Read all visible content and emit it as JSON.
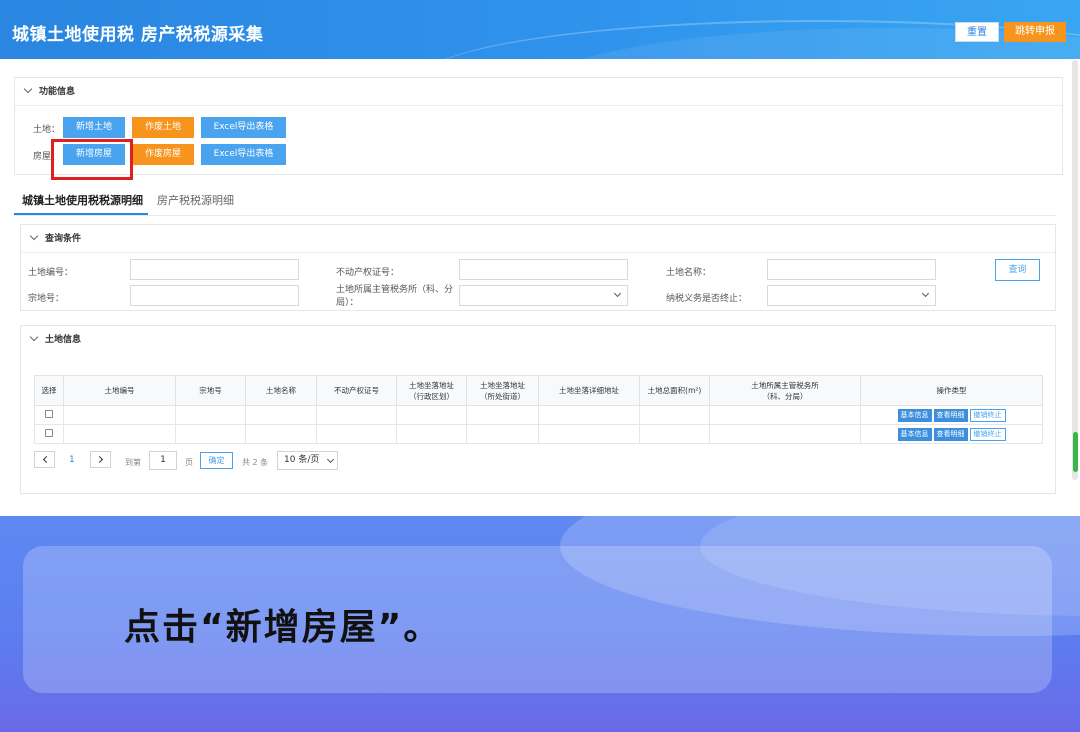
{
  "header": {
    "title": "城镇土地使用税 房产税税源采集",
    "reset_label": "重置",
    "submit_label": "跳转申报"
  },
  "function_panel": {
    "title": "功能信息",
    "land_label": "土地：",
    "house_label": "房屋：",
    "land_buttons": [
      "新增土地",
      "作废土地",
      "Excel导出表格"
    ],
    "house_buttons": [
      "新增房屋",
      "作废房屋",
      "Excel导出表格"
    ]
  },
  "tabs": [
    "城镇土地使用税税源明细",
    "房产税税源明细"
  ],
  "query": {
    "title": "查询条件",
    "fields": {
      "land_no": "土地编号：",
      "property_cert": "不动产权证号：",
      "land_name": "土地名称：",
      "parcel_no": "宗地号：",
      "tax_office": "土地所属主管税务所（科、分局）：",
      "tax_terminated": "纳税义务是否终止："
    },
    "search_label": "查询"
  },
  "land_info": {
    "title": "土地信息",
    "columns": [
      "选择",
      "土地编号",
      "宗地号",
      "土地名称",
      "不动产权证号",
      "土地坐落地址（行政区划）",
      "土地坐落地址（所处街道）",
      "土地坐落详细地址",
      "土地总面积(m²)",
      "土地所属主管税务所（科、分局）",
      "操作类型"
    ],
    "column_lines": {
      "c5": [
        "土地坐落地址",
        "（行政区划）"
      ],
      "c6": [
        "土地坐落地址",
        "（所处街道）"
      ],
      "c9": [
        "土地所属主管税务所",
        "（科、分局）"
      ]
    },
    "row_actions": [
      "基本信息",
      "查看明细",
      "撤销终止"
    ],
    "row_count": 2
  },
  "pagination": {
    "current_page": "1",
    "goto_label": "到第",
    "goto_value": "1",
    "page_unit": "页",
    "confirm_label": "确定",
    "total_label": "共 2 条",
    "page_size": "10 条/页"
  },
  "caption": "点击“新增房屋”。",
  "colors": {
    "primary": "#2a86e0",
    "accent": "#f7941d",
    "highlight": "#e02020"
  }
}
